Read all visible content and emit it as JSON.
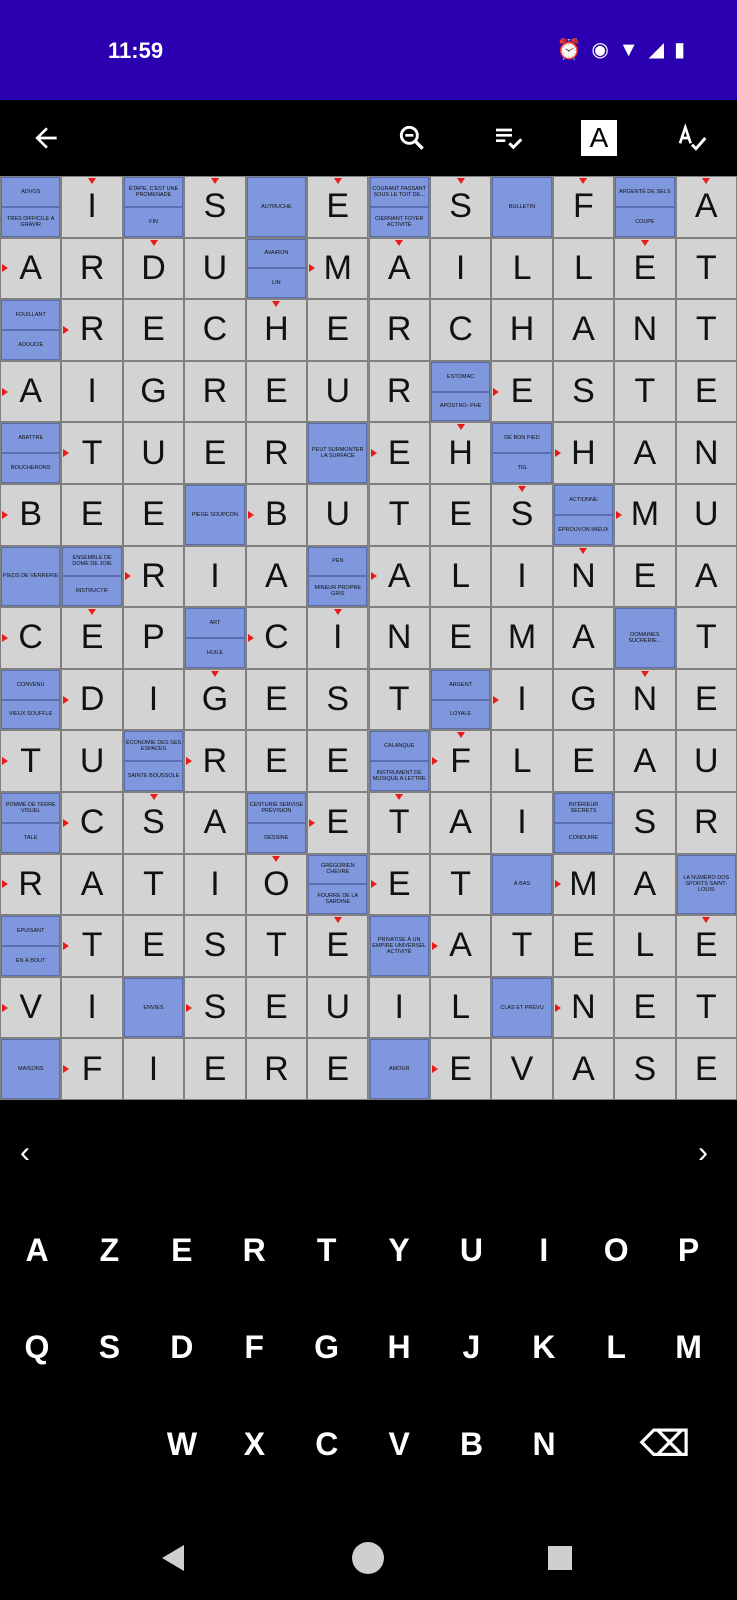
{
  "status": {
    "time": "11:59",
    "icons": [
      "alarm-icon",
      "vibrate-icon",
      "wifi-icon",
      "signal-icon",
      "battery-icon"
    ]
  },
  "toolbar": {
    "icons": [
      "back-arrow-icon",
      "zoom-out-icon",
      "check-list-icon",
      "letter-box-icon",
      "spell-check-icon"
    ],
    "letter_box_label": "A"
  },
  "grid": {
    "rows": [
      [
        "#",
        "I",
        "#",
        "S",
        "#",
        "E",
        "#",
        "S",
        "#",
        "F",
        "#",
        "A"
      ],
      [
        "A",
        "R",
        "D",
        "U",
        "#",
        "M",
        "A",
        "I",
        "L",
        "L",
        "E",
        "T"
      ],
      [
        "#",
        "R",
        "E",
        "C",
        "H",
        "E",
        "R",
        "C",
        "H",
        "A",
        "N",
        "T"
      ],
      [
        "A",
        "I",
        "G",
        "R",
        "E",
        "U",
        "R",
        "#",
        "E",
        "S",
        "T",
        "E"
      ],
      [
        "#",
        "T",
        "U",
        "E",
        "R",
        "#",
        "E",
        "H",
        "#",
        "H",
        "A",
        "N"
      ],
      [
        "B",
        "E",
        "E",
        "#",
        "B",
        "U",
        "T",
        "E",
        "S",
        "#",
        "M",
        "U"
      ],
      [
        "#",
        "#",
        "R",
        "I",
        "A",
        "#",
        "A",
        "L",
        "I",
        "N",
        "E",
        "A"
      ],
      [
        "C",
        "E",
        "P",
        "#",
        "C",
        "I",
        "N",
        "E",
        "M",
        "A",
        "#",
        "T"
      ],
      [
        "#",
        "D",
        "I",
        "G",
        "E",
        "S",
        "T",
        "#",
        "I",
        "G",
        "N",
        "E"
      ],
      [
        "T",
        "U",
        "#",
        "R",
        "E",
        "E",
        "#",
        "F",
        "L",
        "E",
        "A",
        "U"
      ],
      [
        "#",
        "C",
        "S",
        "A",
        "#",
        "E",
        "T",
        "A",
        "I",
        "#",
        "S",
        "R"
      ],
      [
        "R",
        "A",
        "T",
        "I",
        "O",
        "#",
        "E",
        "T",
        "#",
        "M",
        "A",
        "#"
      ],
      [
        "#",
        "T",
        "E",
        "S",
        "T",
        "E",
        "#",
        "A",
        "T",
        "E",
        "L",
        "E"
      ],
      [
        "V",
        "I",
        "#",
        "S",
        "E",
        "U",
        "I",
        "L",
        "#",
        "N",
        "E",
        "T"
      ],
      [
        "#",
        "F",
        "I",
        "E",
        "R",
        "E",
        "#",
        "E",
        "V",
        "A",
        "S",
        "E"
      ]
    ],
    "defs": {
      "0_0": [
        "ADVOS",
        "TRÈS DIFFICILE À GRAVIR"
      ],
      "0_2": [
        "ÉTAPE, C'EST UNE PROMENADE",
        "FIN"
      ],
      "0_4": [
        "AUTRUCHE"
      ],
      "0_6": [
        "COURANT PASSANT SOUS LE TOIT DE...",
        "CIERNANT FOYER ACTIVITÉ"
      ],
      "0_8": [
        "BULLETIN"
      ],
      "0_10": [
        "ARGENTÉ DE SELS",
        "COUPE"
      ],
      "1_4": [
        "AVAIRON",
        "LIN"
      ],
      "2_0": [
        "FOUILLANT",
        "ADOUCIE"
      ],
      "3_7": [
        "ESTOMAC",
        "APOSTRO- PHE"
      ],
      "4_0": [
        "ABATTRE",
        "BOUCHERONS"
      ],
      "4_5": [
        "PEUT SURMONTER LA SURFACE"
      ],
      "4_8": [
        "DE BON PIED",
        "TIG"
      ],
      "5_3": [
        "PIEGE SOUPCON"
      ],
      "5_9": [
        "ACTIONNE",
        "ÉPROUVON MIEUX"
      ],
      "6_0": [
        "PIEDS DE VERRERIE"
      ],
      "6_1": [
        "ENSEMBLE DE DOME DE JOIE",
        "INSTRUCTIF"
      ],
      "6_5": [
        "PEN",
        "MINEUR PROPRE GRIS"
      ],
      "7_3": [
        "ART",
        "HUILE"
      ],
      "7_10": [
        "DOMAINES SUCRERIE..."
      ],
      "8_0": [
        "CONVENU",
        "VIEUX SOUFFLE"
      ],
      "8_7": [
        "ARGENT",
        "LOYALE"
      ],
      "9_2": [
        "ÉCONOMIE DES SES ESPACES",
        "SAINTE BOUSSOLE"
      ],
      "9_6": [
        "CALANQUE",
        "INSTRUMENT DE MUSIQUE A LETTRE"
      ],
      "10_0": [
        "POMME DE TERRE VISUEL",
        "TALE"
      ],
      "10_4": [
        "CENTURIE SERVISE PRÉVISION",
        "DESSINE"
      ],
      "10_9": [
        "INTÉRIEUR SECRETS",
        "CONDUIRE"
      ],
      "11_5": [
        "GRÉGORIEN CHÈVRE",
        "FOURRE DE LA SARDINE"
      ],
      "11_8": [
        "À BAS"
      ],
      "11_11": [
        "LA NUMÉRO DOS SPORTS SAINT-LOUIS"
      ],
      "12_0": [
        "ÉPUISANT",
        "EN À BOUT"
      ],
      "12_6": [
        "PRIVATISE À UN EMPIRE UNIVERSEL ACTIVITÉ"
      ],
      "13_2": [
        "ENVIES"
      ],
      "13_8": [
        "CLAS ET PRÉVU"
      ],
      "14_0": [
        "MAISONS"
      ],
      "14_6": [
        "AMOUR"
      ]
    }
  },
  "nav": {
    "prev": "‹",
    "next": "›"
  },
  "keyboard": {
    "row1": [
      "A",
      "Z",
      "E",
      "R",
      "T",
      "Y",
      "U",
      "I",
      "O",
      "P"
    ],
    "row2": [
      "Q",
      "S",
      "D",
      "F",
      "G",
      "H",
      "J",
      "K",
      "L",
      "M"
    ],
    "row3": [
      "W",
      "X",
      "C",
      "V",
      "B",
      "N"
    ],
    "backspace": "⌫"
  }
}
